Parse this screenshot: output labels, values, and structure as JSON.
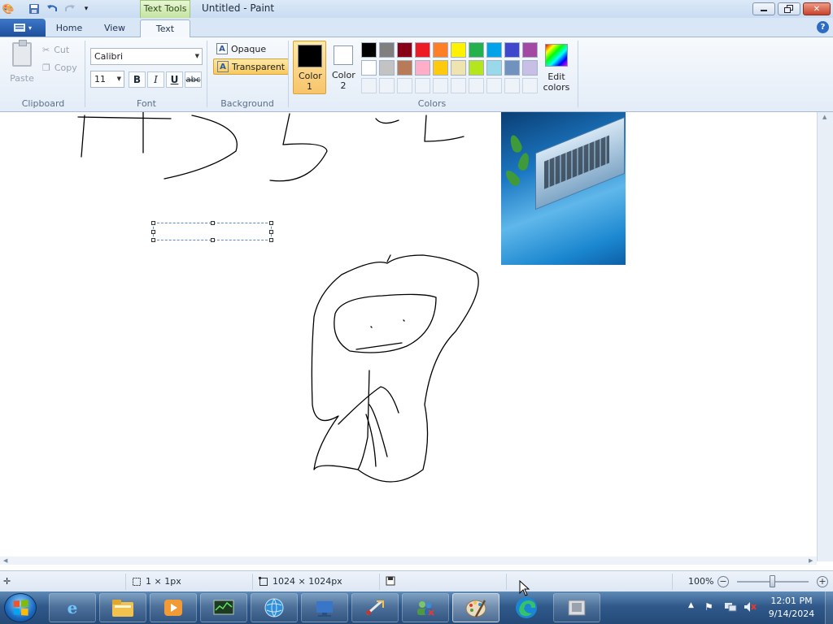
{
  "window": {
    "title": "Untitled - Paint",
    "contextual_tab": "Text Tools"
  },
  "ribbon_tabs": [
    {
      "label": "Home",
      "active": false
    },
    {
      "label": "View",
      "active": false
    },
    {
      "label": "Text",
      "active": true
    }
  ],
  "clipboard": {
    "group_label": "Clipboard",
    "paste_label": "Paste",
    "cut_label": "Cut",
    "copy_label": "Copy"
  },
  "font": {
    "group_label": "Font",
    "family": "Calibri",
    "size": "11",
    "bold_label": "B",
    "italic_label": "I",
    "underline_label": "U",
    "strike_label": "abc"
  },
  "background": {
    "group_label": "Background",
    "opaque_label": "Opaque",
    "transparent_label": "Transparent",
    "selected": "transparent"
  },
  "colors": {
    "group_label": "Colors",
    "color1_label": "Color 1",
    "color2_label": "Color 2",
    "color1": "#000000",
    "color2": "#ffffff",
    "edit_label": "Edit colors",
    "palette_row1": [
      "#000000",
      "#7f7f7f",
      "#880015",
      "#ed1c24",
      "#ff7f27",
      "#fff200",
      "#22b14c",
      "#00a2e8",
      "#3f48cc",
      "#a349a4"
    ],
    "palette_row2": [
      "#ffffff",
      "#c3c3c3",
      "#b97a57",
      "#ffaec9",
      "#ffc90e",
      "#efe4b0",
      "#b5e61d",
      "#99d9ea",
      "#7092be",
      "#c8bfe7"
    ]
  },
  "status": {
    "selection_size": "1 × 1px",
    "canvas_size": "1024 × 1024px",
    "zoom": "100%"
  },
  "taskbar": {
    "time": "12:01 PM",
    "date": "9/14/2024"
  }
}
